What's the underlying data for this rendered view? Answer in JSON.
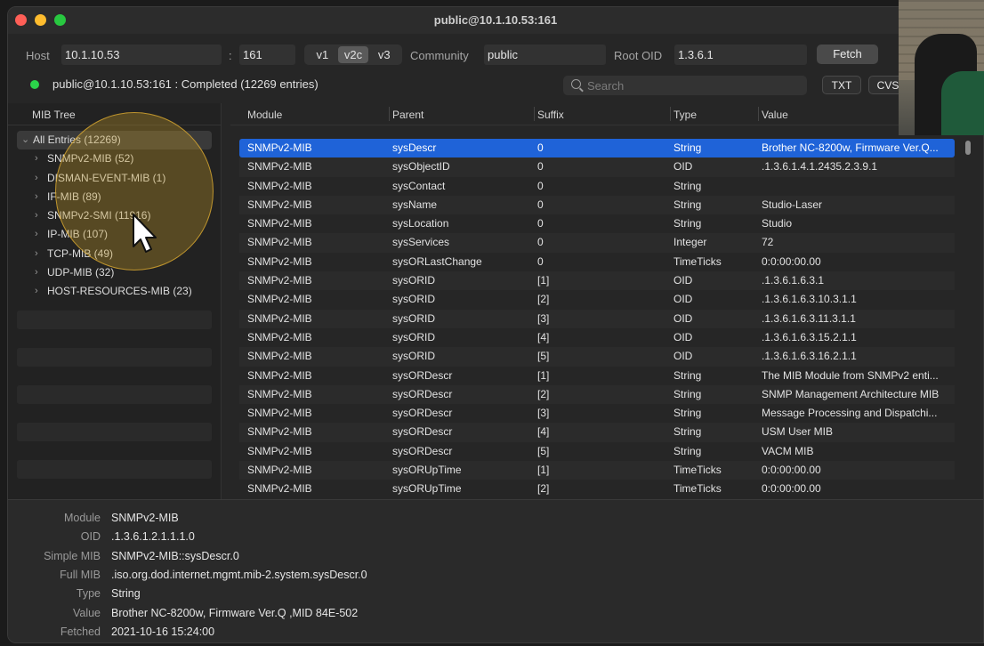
{
  "window": {
    "title": "public@10.1.10.53:161"
  },
  "toolbar": {
    "host_label": "Host",
    "host_value": "10.1.10.53",
    "port_separator": ":",
    "port_value": "161",
    "versions": [
      "v1",
      "v2c",
      "v3"
    ],
    "active_version": "v2c",
    "community_label": "Community",
    "community_value": "public",
    "root_oid_label": "Root OID",
    "root_oid_value": "1.3.6.1",
    "fetch_label": "Fetch"
  },
  "status": {
    "text": "public@10.1.10.53:161 : Completed (12269 entries)",
    "color": "#2bd34a"
  },
  "search": {
    "placeholder": "Search"
  },
  "export": {
    "txt_label": "TXT",
    "csv_label": "CVS"
  },
  "sidebar": {
    "header": "MIB Tree",
    "root": "All Entries (12269)",
    "items": [
      "SNMPv2-MIB (52)",
      "DISMAN-EVENT-MIB (1)",
      "IF-MIB (89)",
      "SNMPv2-SMI (11916)",
      "IP-MIB (107)",
      "TCP-MIB (49)",
      "UDP-MIB (32)",
      "HOST-RESOURCES-MIB (23)"
    ]
  },
  "table": {
    "columns": [
      "Module",
      "Parent",
      "Suffix",
      "Type",
      "Value"
    ],
    "rows": [
      [
        "SNMPv2-MIB",
        "sysDescr",
        "0",
        "String",
        "Brother NC-8200w, Firmware Ver.Q..."
      ],
      [
        "SNMPv2-MIB",
        "sysObjectID",
        "0",
        "OID",
        ".1.3.6.1.4.1.2435.2.3.9.1"
      ],
      [
        "SNMPv2-MIB",
        "sysContact",
        "0",
        "String",
        ""
      ],
      [
        "SNMPv2-MIB",
        "sysName",
        "0",
        "String",
        "Studio-Laser"
      ],
      [
        "SNMPv2-MIB",
        "sysLocation",
        "0",
        "String",
        "Studio"
      ],
      [
        "SNMPv2-MIB",
        "sysServices",
        "0",
        "Integer",
        "72"
      ],
      [
        "SNMPv2-MIB",
        "sysORLastChange",
        "0",
        "TimeTicks",
        "0:0:00:00.00"
      ],
      [
        "SNMPv2-MIB",
        "sysORID",
        "[1]",
        "OID",
        ".1.3.6.1.6.3.1"
      ],
      [
        "SNMPv2-MIB",
        "sysORID",
        "[2]",
        "OID",
        ".1.3.6.1.6.3.10.3.1.1"
      ],
      [
        "SNMPv2-MIB",
        "sysORID",
        "[3]",
        "OID",
        ".1.3.6.1.6.3.11.3.1.1"
      ],
      [
        "SNMPv2-MIB",
        "sysORID",
        "[4]",
        "OID",
        ".1.3.6.1.6.3.15.2.1.1"
      ],
      [
        "SNMPv2-MIB",
        "sysORID",
        "[5]",
        "OID",
        ".1.3.6.1.6.3.16.2.1.1"
      ],
      [
        "SNMPv2-MIB",
        "sysORDescr",
        "[1]",
        "String",
        "The MIB Module from SNMPv2 enti..."
      ],
      [
        "SNMPv2-MIB",
        "sysORDescr",
        "[2]",
        "String",
        "SNMP Management Architecture MIB"
      ],
      [
        "SNMPv2-MIB",
        "sysORDescr",
        "[3]",
        "String",
        "Message Processing and Dispatchi..."
      ],
      [
        "SNMPv2-MIB",
        "sysORDescr",
        "[4]",
        "String",
        "USM User MIB"
      ],
      [
        "SNMPv2-MIB",
        "sysORDescr",
        "[5]",
        "String",
        "VACM MIB"
      ],
      [
        "SNMPv2-MIB",
        "sysORUpTime",
        "[1]",
        "TimeTicks",
        "0:0:00:00.00"
      ],
      [
        "SNMPv2-MIB",
        "sysORUpTime",
        "[2]",
        "TimeTicks",
        "0:0:00:00.00"
      ]
    ],
    "selected_row": 0
  },
  "detail": {
    "fields": [
      {
        "key": "Module",
        "value": "SNMPv2-MIB"
      },
      {
        "key": "OID",
        "value": ".1.3.6.1.2.1.1.1.0"
      },
      {
        "key": "Simple MIB",
        "value": "SNMPv2-MIB::sysDescr.0"
      },
      {
        "key": "Full MIB",
        "value": ".iso.org.dod.internet.mgmt.mib-2.system.sysDescr.0"
      },
      {
        "key": "Type",
        "value": "String"
      },
      {
        "key": "Value",
        "value": "Brother NC-8200w, Firmware Ver.Q  ,MID 84E-502"
      },
      {
        "key": "Fetched",
        "value": "2021-10-16 15:24:00"
      }
    ]
  },
  "colors": {
    "selection": "#1f63d8",
    "status_ok": "#2bd34a",
    "highlight": "#e1af32"
  },
  "icons": [
    "close-window-icon",
    "minimize-window-icon",
    "zoom-window-icon",
    "search-icon",
    "chevron-right-icon",
    "chevron-down-icon",
    "pointer-cursor-icon"
  ]
}
